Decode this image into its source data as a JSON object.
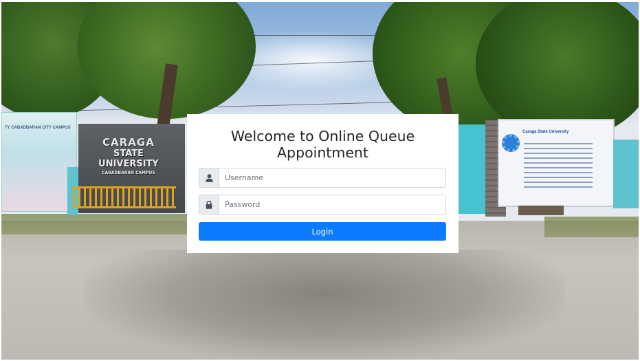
{
  "background": {
    "left_banner": "TY CABADBARAN CITY CAMPUS",
    "sign": {
      "line1": "CARAGA",
      "line2": "STATE",
      "line3": "UNIVERSITY",
      "line4": "CABADBARAN CAMPUS"
    },
    "board_title": "Caraga State University"
  },
  "login": {
    "title": "Welcome to Online Queue Appointment",
    "username_placeholder": "Username",
    "password_placeholder": "Password",
    "button_label": "Login"
  },
  "colors": {
    "primary": "#0d7bfd",
    "addon": "#e9ecef",
    "border": "#ced4da"
  },
  "icons": {
    "username": "user-icon",
    "password": "lock-icon"
  }
}
